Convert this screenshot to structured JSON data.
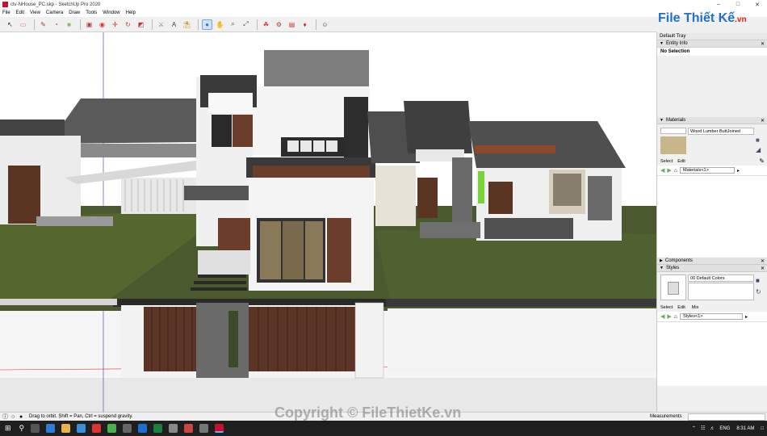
{
  "window": {
    "title": "ctv-NHouse_PC.skp - SketchUp Pro 2020",
    "min": "–",
    "max": "□",
    "close": "✕"
  },
  "menu": [
    "File",
    "Edit",
    "View",
    "Camera",
    "Draw",
    "Tools",
    "Window",
    "Help"
  ],
  "toolbar_icons": [
    {
      "name": "select-icon",
      "glyph": "↖",
      "color": "#222"
    },
    {
      "name": "eraser-icon",
      "glyph": "▭",
      "color": "#e0548a"
    },
    {
      "name": "pencil-icon",
      "glyph": "✎",
      "color": "#a33"
    },
    {
      "name": "arc-icon",
      "glyph": "◔",
      "color": "#c33"
    },
    {
      "name": "rectangle-icon",
      "glyph": "■",
      "color": "#8b6"
    },
    {
      "name": "push-pull-icon",
      "glyph": "▣",
      "color": "#a44"
    },
    {
      "name": "offset-icon",
      "glyph": "◉",
      "color": "#d33"
    },
    {
      "name": "move-icon",
      "glyph": "✛",
      "color": "#c22"
    },
    {
      "name": "rotate-icon",
      "glyph": "↻",
      "color": "#d33"
    },
    {
      "name": "scale-icon",
      "glyph": "◩",
      "color": "#b33"
    },
    {
      "name": "tape-measure-icon",
      "glyph": "⚔",
      "color": "#776"
    },
    {
      "name": "text-icon",
      "glyph": "A",
      "color": "#444"
    },
    {
      "name": "paint-bucket-icon",
      "glyph": "⛱",
      "color": "#c93"
    },
    {
      "name": "orbit-icon",
      "glyph": "●",
      "color": "#47a"
    },
    {
      "name": "pan-icon",
      "glyph": "✋",
      "color": "#c96"
    },
    {
      "name": "zoom-icon",
      "glyph": "⌕",
      "color": "#555"
    },
    {
      "name": "zoom-extents-icon",
      "glyph": "⤢",
      "color": "#555"
    },
    {
      "name": "warehouse-icon",
      "glyph": "☘",
      "color": "#c33"
    },
    {
      "name": "extension-icon",
      "glyph": "⚙",
      "color": "#c33"
    },
    {
      "name": "layout-icon",
      "glyph": "▤",
      "color": "#c33"
    },
    {
      "name": "ruby-icon",
      "glyph": "♦",
      "color": "#c22"
    },
    {
      "name": "account-icon",
      "glyph": "☺",
      "color": "#444"
    }
  ],
  "tray": {
    "title": "Default Tray",
    "entity_info": {
      "header": "Entity Info",
      "value": "No Selection"
    },
    "materials": {
      "header": "Materials",
      "material_name": "Wood Lumber ButtJoined",
      "tab_select": "Select",
      "tab_edit": "Edit",
      "collection": "Materials<1>",
      "swatch_color": "#c8b58a"
    },
    "components": {
      "header": "Components"
    },
    "styles": {
      "header": "Styles",
      "style_name": "00 Default Colors",
      "tab_select": "Select",
      "tab_edit": "Edit",
      "tab_mix": "Mix",
      "collection": "Styles<1>"
    }
  },
  "status": {
    "hint": "Drag to orbit. Shift = Pan, Ctrl = suspend gravity.",
    "measurements_label": "Measurements"
  },
  "taskbar": {
    "lang": "ENG",
    "time": "8:31 AM"
  },
  "watermark": "Copyright © FileThietKe.vn",
  "logo": {
    "main": "File Thiết Kế",
    "tld": ".vn"
  },
  "colors": {
    "accent": "#1e6fd0",
    "lawn": "#4a5a2c",
    "wall": "#f2f2f2",
    "wood": "#6a3e2a"
  }
}
